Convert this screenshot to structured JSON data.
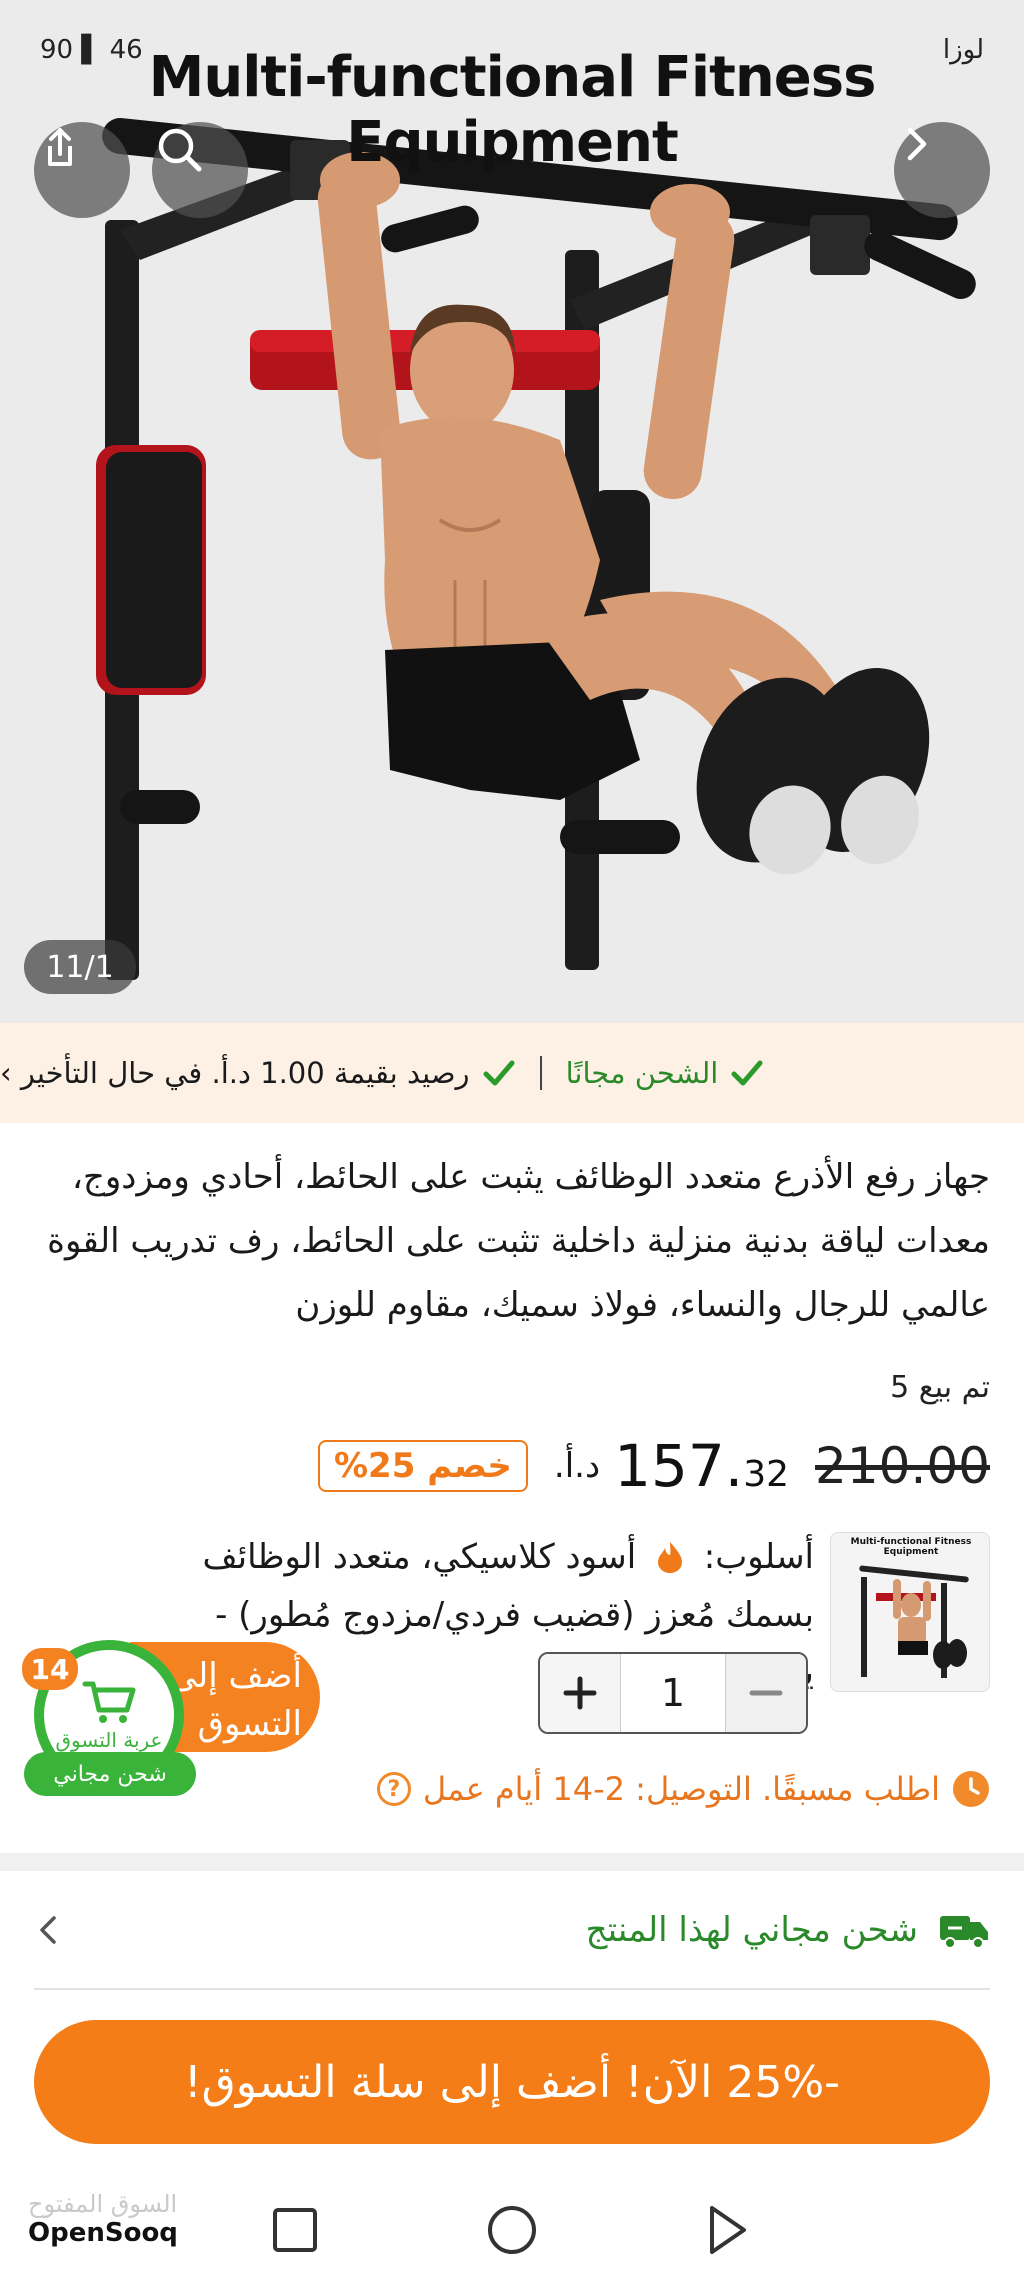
{
  "status_bar": {
    "left_text": "90 ▌ 46",
    "right_text": "لوزا"
  },
  "hero": {
    "title": "Multi-functional Fitness Equipment",
    "counter": "11/1",
    "share_icon": "share-icon",
    "search_icon": "search-icon",
    "next_icon": "chevron-right-icon"
  },
  "shipping_strip": {
    "free_shipping": "الشحن مجانًا",
    "credit": "رصيد بقيمة 1.00 د.أ. في حال التأخير ›"
  },
  "product": {
    "description": "جهاز رفع الأذرع متعدد الوظائف يثبت على الحائط، أحادي ومزدوج، معدات لياقة بدنية منزلية داخلية تثبت على الحائط، رف تدريب القوة عالمي للرجال والنساء، فولاذ سميك، مقاوم للوزن",
    "sold": "تم بيع 5",
    "old_price": "210.00",
    "price_int": "157.",
    "price_dec": "32",
    "currency": "د.أ.",
    "discount": "خصم 25%"
  },
  "variant": {
    "label": "أسلوب:",
    "text": "أسود كلاسيكي، متعدد الوظائف بسمك مُعزز (قضيب فردي/مزدوج مُطور) - يدع...",
    "thumb_caption": "Multi-functional Fitness Equipment",
    "quantity": "1",
    "add_to_cart": "أضف إلى التسوق"
  },
  "floating_cart": {
    "count": "14",
    "label": "عربة التسوق",
    "free": "شحن مجاني"
  },
  "delivery": {
    "text": "اطلب مسبقًا. التوصيل: 2-14 أيام عمل"
  },
  "free_ship_row": {
    "text": "شحن مجاني لهذا المنتج"
  },
  "cta": {
    "label": "-25% الآن! أضف إلى سلة التسوق!"
  },
  "nav": {
    "logo_en": "OpenSooq",
    "logo_ar": "السوق المفتوح"
  },
  "colors": {
    "accent": "#f58220",
    "green": "#2a8a2a",
    "strip_bg": "#fdf1e6"
  }
}
